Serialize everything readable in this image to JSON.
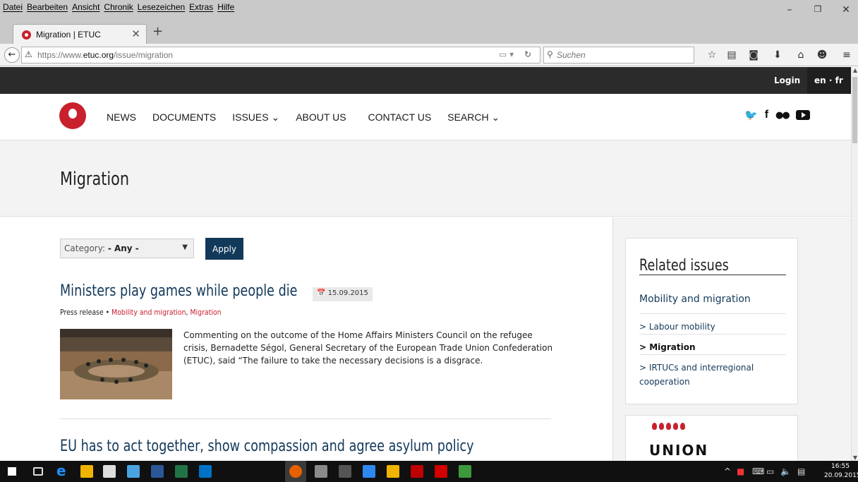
{
  "browser": {
    "menu": [
      "Datei",
      "Bearbeiten",
      "Ansicht",
      "Chronik",
      "Lesezeichen",
      "Extras",
      "Hilfe"
    ],
    "tab_title": "Migration | ETUC",
    "url_prefix": "https://www.",
    "url_domain": "etuc.org",
    "url_path": "/issue/migration",
    "search_placeholder": "Suchen"
  },
  "site": {
    "login": "Login",
    "lang": "en · fr",
    "nav": [
      "NEWS",
      "DOCUMENTS",
      "ISSUES ⌄",
      "ABOUT US",
      "CONTACT US",
      "SEARCH ⌄"
    ],
    "page_title": "Migration"
  },
  "filter": {
    "label": "Category:",
    "value": "- Any -",
    "apply": "Apply"
  },
  "articles": [
    {
      "title": "Ministers play games while people die",
      "date": "15.09.2015",
      "type": "Press release",
      "tag1": "Mobility and migration",
      "tag2": "Migration",
      "excerpt": "Commenting on the outcome of the Home Affairs Ministers Council on the refugee crisis, Bernadette Ségol, General Secretary of the European Trade Union Confederation (ETUC), said “The failure to take the necessary decisions is a disgrace."
    },
    {
      "title": "EU has to act together, show compassion and agree asylum policy"
    }
  ],
  "sidebar": {
    "heading": "Related issues",
    "main_link": "Mobility and migration",
    "items": [
      "> Labour mobility",
      "> Migration",
      "> IRTUCs and interregional cooperation"
    ],
    "union_word": "UNION"
  },
  "taskbar": {
    "time": "16:55",
    "date": "20.09.2015"
  }
}
